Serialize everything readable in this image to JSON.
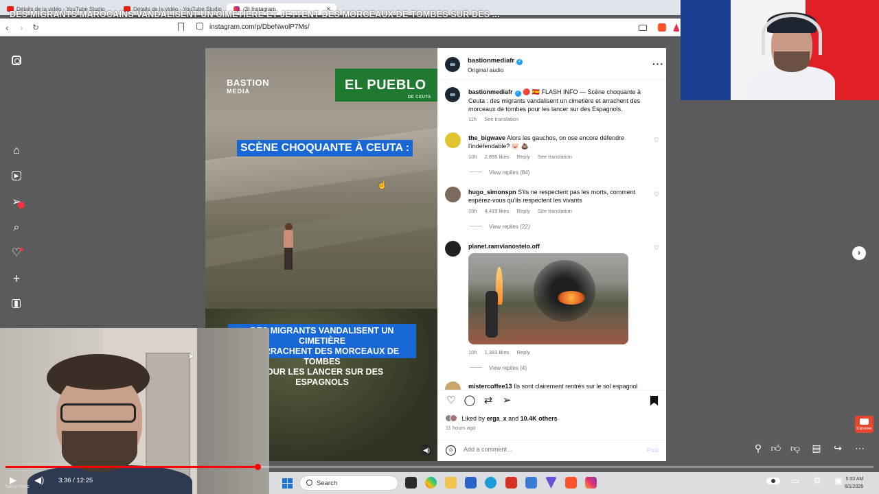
{
  "browser": {
    "tabs": [
      {
        "label": "Détails de la vidéo - YouTube Studio",
        "type": "youtube"
      },
      {
        "label": "Détails de la vidéo - YouTube Studio",
        "type": "youtube"
      },
      {
        "label": "(3) Instagram",
        "type": "instagram"
      }
    ],
    "url": "instagram.com/p/DbeNwolP7Ms/",
    "overlay_title": "DES MIGRANTS MAROCAINS VANDALISENT UN CIMETIÈRE ET JETTENT DES MORCEAUX DE TOMBES SUR DES ..."
  },
  "instagram": {
    "sidebar_icons": [
      "instagram-logo-icon",
      "home-icon",
      "reels-icon",
      "messages-icon",
      "search-icon",
      "notifications-icon",
      "create-icon",
      "dashboard-icon"
    ],
    "video": {
      "brand_left": "BASTION",
      "brand_left_sub": "MEDIA",
      "brand_right": "EL PUEBLO",
      "brand_right_sub": "DE CEUTA",
      "headline": "SCÈNE CHOQUANTE À CEUTA :",
      "caption_lines": [
        "DES MIGRANTS VANDALISENT UN CIMETIÈRE",
        "ET ARRACHENT DES MORCEAUX DE TOMBES",
        "POUR LES LANCER SUR DES ESPAGNOLS"
      ]
    },
    "post": {
      "author": "bastionmediafr",
      "audio": "Original audio",
      "caption_user": "bastionmediafr",
      "caption_text": "🔴 🇪🇸 FLASH INFO — Scène choquante à Ceuta : des migrants vandalisent un cimetière et arrachent des morceaux de tombes pour les lancer sur des Espagnols.",
      "caption_time": "11h",
      "see_translation": "See translation",
      "comments": [
        {
          "user": "the_bigwave",
          "text": "Alors les gauchos, on ose encore défendre l'indéfendable? 🐷 💩",
          "time": "10h",
          "likes": "2,895 likes",
          "reply": "Reply",
          "translate": "See translation",
          "view_replies": "View replies (84)"
        },
        {
          "user": "hugo_simonspn",
          "text": "S'ils ne respectent pas les morts, comment espérez-vous qu'ils respectent les vivants",
          "time": "10h",
          "likes": "4,419 likes",
          "reply": "Reply",
          "translate": "See translation",
          "view_replies": "View replies (22)"
        },
        {
          "user": "planet.ramvianostelo.off",
          "text": "",
          "time": "10h",
          "likes": "1,383 likes",
          "reply": "Reply",
          "view_replies": "View replies (4)"
        },
        {
          "user": "mistercoffee13",
          "text": "Ils sont clairement rentrés sur le sol espagnol"
        }
      ],
      "liked_by_prefix": "Liked by",
      "liked_by_user": "erga_x",
      "liked_by_and": "and",
      "liked_by_others": "10.4K others",
      "posted_ago": "11 hours ago",
      "comment_placeholder": "Add a comment...",
      "post_label": "Post"
    }
  },
  "player": {
    "time": "3:36 / 12:25",
    "progress": 0.29,
    "caption": "Nang rarac"
  },
  "taskbar": {
    "search_label": "Search",
    "clock_time": "5:33 AM",
    "clock_date": "8/1/2026"
  },
  "colors": {
    "youtube_red": "#ff0000",
    "instagram_verified": "#1d9bf0",
    "video_caption_blue": "#1767d6",
    "pueblo_green": "#1f7a2f"
  }
}
